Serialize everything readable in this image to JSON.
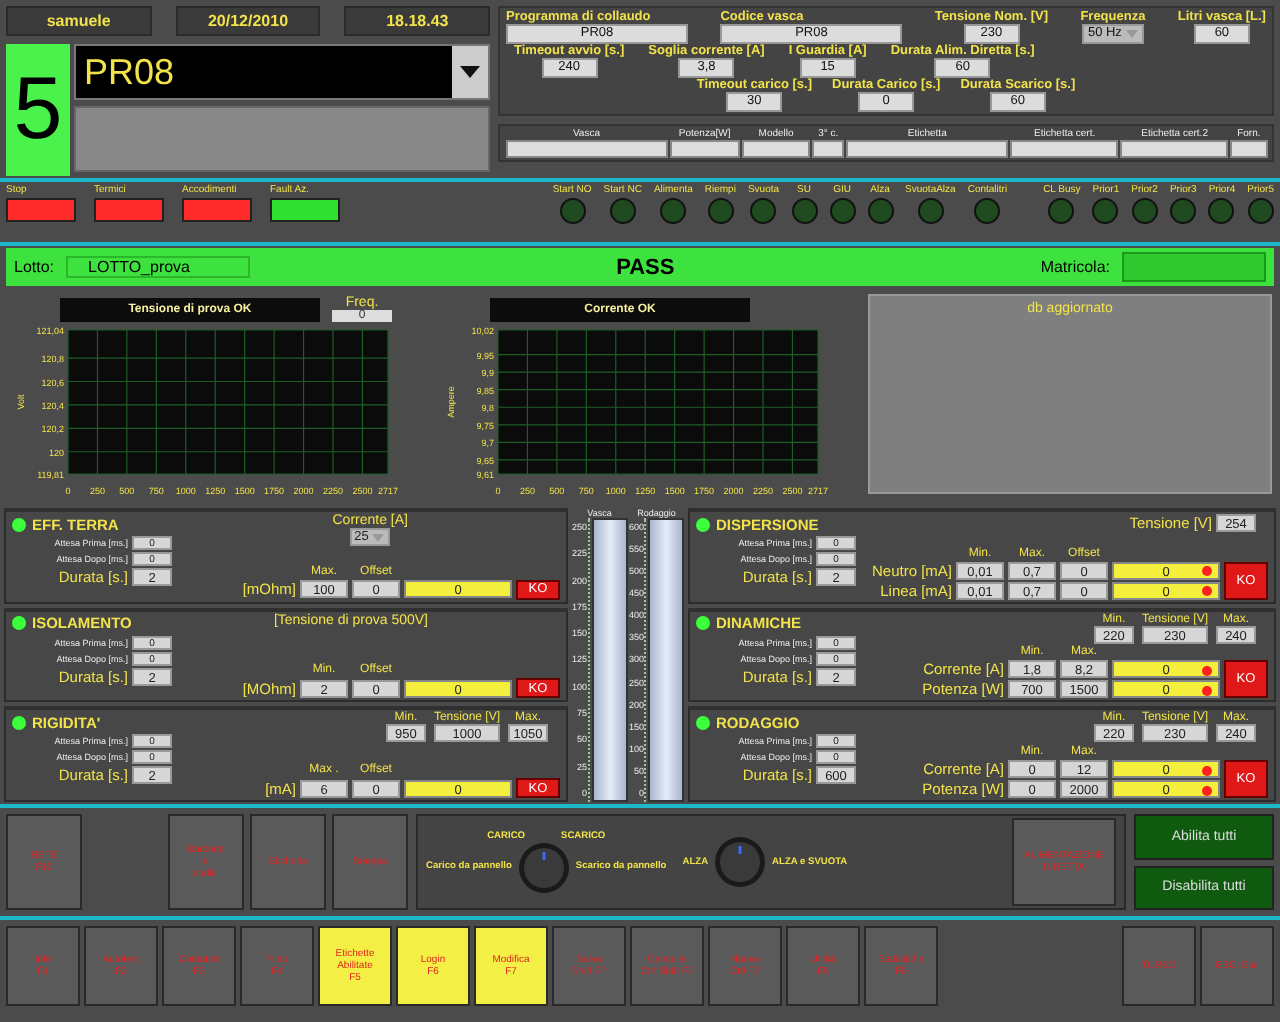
{
  "header": {
    "user": "samuele",
    "date": "20/12/2010",
    "time": "18.18.43",
    "station": "5",
    "program": "PR08"
  },
  "parameters": [
    [
      {
        "label": "Programma di collaudo",
        "value": "PR08",
        "kind": "wide"
      },
      {
        "label": "Codice vasca",
        "value": "PR08",
        "kind": "wide"
      },
      {
        "label": "Tensione Nom. [V]",
        "value": "230",
        "kind": "box"
      },
      {
        "label": "Frequenza",
        "value": "50 Hz",
        "kind": "select"
      },
      {
        "label": "Litri vasca [L.]",
        "value": "60",
        "kind": "box"
      }
    ],
    [
      {
        "label": "Timeout avvio [s.]",
        "value": "240",
        "kind": "box"
      },
      {
        "label": "Soglia corrente [A]",
        "value": "3,8",
        "kind": "box"
      },
      {
        "label": "I Guardia [A]",
        "value": "15",
        "kind": "box"
      },
      {
        "label": "Durata Alim. Diretta [s.]",
        "value": "60",
        "kind": "box"
      }
    ],
    [
      {
        "label": "Timeout carico [s.]",
        "value": "30",
        "kind": "box"
      },
      {
        "label": "Durata Carico [s.]",
        "value": "0",
        "kind": "box"
      },
      {
        "label": "Durata Scarico [s.]",
        "value": "60",
        "kind": "box"
      }
    ]
  ],
  "label_table": {
    "columns": [
      "Vasca",
      "Potenza[W]",
      "Modello",
      "3° c.",
      "Etichetta",
      "Etichetta cert.",
      "Etichetta cert.2",
      "Forn."
    ]
  },
  "alarms": [
    {
      "label": "Stop",
      "color": "#ff2a2a"
    },
    {
      "label": "Termici",
      "color": "#ff2a2a"
    },
    {
      "label": "Accodimenti",
      "color": "#ff2a2a"
    },
    {
      "label": "Fault Az.",
      "color": "#30e030"
    }
  ],
  "lamps": [
    {
      "label": "Start NO",
      "on": false
    },
    {
      "label": "Start NC",
      "on": false
    },
    {
      "label": "Alimenta",
      "on": false
    },
    {
      "label": "Riempi",
      "on": false
    },
    {
      "label": "Svuota",
      "on": false
    },
    {
      "label": "SU",
      "on": false
    },
    {
      "label": "GIU",
      "on": false
    },
    {
      "label": "Alza",
      "on": false
    },
    {
      "label": "SvuotaAlza",
      "on": false
    },
    {
      "label": "Contalitri",
      "on": false
    },
    {
      "label": "CL Busy",
      "on": false
    },
    {
      "label": "Prior1",
      "on": false
    },
    {
      "label": "Prior2",
      "on": false
    },
    {
      "label": "Prior3",
      "on": false
    },
    {
      "label": "Prior4",
      "on": false
    },
    {
      "label": "Prior5",
      "on": false
    }
  ],
  "lot": {
    "label": "Lotto:",
    "value": "LOTTO_prova",
    "result": "PASS",
    "serial_label": "Matricola:"
  },
  "charts": [
    {
      "title": "Tensione di prova OK",
      "chart_data": {
        "type": "line",
        "grid": true,
        "ylabel": "Volt",
        "xlim": [
          0,
          2717
        ],
        "ylim": [
          119.81,
          121.04
        ],
        "xticks": [
          0,
          250,
          500,
          750,
          1000,
          1250,
          1500,
          1750,
          2000,
          2250,
          2500,
          2717
        ],
        "yticks": [
          {
            "value": 119.81,
            "label": "119,81"
          },
          {
            "value": 120,
            "label": "120"
          },
          {
            "value": 120.2,
            "label": "120,2"
          },
          {
            "value": 120.4,
            "label": "120,4"
          },
          {
            "value": 120.6,
            "label": "120,6"
          },
          {
            "value": 120.8,
            "label": "120,8"
          },
          {
            "value": 121.04,
            "label": "121,04"
          }
        ]
      }
    },
    {
      "title": "Corrente OK",
      "chart_data": {
        "type": "line",
        "grid": true,
        "ylabel": "Ampere",
        "xlim": [
          0,
          2717
        ],
        "ylim": [
          9.61,
          10.02
        ],
        "xticks": [
          0,
          250,
          500,
          750,
          1000,
          1250,
          1500,
          1750,
          2000,
          2250,
          2500,
          2717
        ],
        "yticks": [
          {
            "value": 9.61,
            "label": "9,61"
          },
          {
            "value": 9.65,
            "label": "9,65"
          },
          {
            "value": 9.7,
            "label": "9,7"
          },
          {
            "value": 9.75,
            "label": "9,75"
          },
          {
            "value": 9.8,
            "label": "9,8"
          },
          {
            "value": 9.85,
            "label": "9,85"
          },
          {
            "value": 9.9,
            "label": "9,9"
          },
          {
            "value": 9.95,
            "label": "9,95"
          },
          {
            "value": 10.02,
            "label": "10,02"
          }
        ]
      }
    }
  ],
  "frequency": {
    "label": "Freq.",
    "value": "0"
  },
  "db_status": "db aggiornato",
  "tests_left": [
    {
      "title": "EFF. TERRA",
      "on": true,
      "attesa_prima": {
        "label": "Attesa Prima [ms.]",
        "value": "0"
      },
      "attesa_dopo": {
        "label": "Attesa Dopo [ms.]",
        "value": "0"
      },
      "durata": {
        "label": "Durata [s.]",
        "value": "2"
      },
      "top": [
        {
          "kind": "select",
          "label": "Corrente [A]",
          "value": "25"
        }
      ],
      "measure": {
        "headers": [
          "Max.",
          "Offset"
        ],
        "rows": [
          {
            "label": "[mOhm]",
            "values": [
              "100",
              "0"
            ],
            "result": "0",
            "alarm": false
          }
        ]
      },
      "verdict": "KO"
    },
    {
      "title": "ISOLAMENTO",
      "on": true,
      "attesa_prima": {
        "label": "Attesa Prima [ms.]",
        "value": "0"
      },
      "attesa_dopo": {
        "label": "Attesa Dopo [ms.]",
        "value": "0"
      },
      "durata": {
        "label": "Durata [s.]",
        "value": "2"
      },
      "top": [
        {
          "kind": "note",
          "text": "[Tensione di prova 500V]"
        }
      ],
      "measure": {
        "headers": [
          "Min.",
          "Offset"
        ],
        "rows": [
          {
            "label": "[MOhm]",
            "values": [
              "2",
              "0"
            ],
            "result": "0",
            "alarm": false
          }
        ]
      },
      "verdict": "KO"
    },
    {
      "title": "RIGIDITA'",
      "on": true,
      "attesa_prima": {
        "label": "Attesa Prima [ms.]",
        "value": "0"
      },
      "attesa_dopo": {
        "label": "Attesa Dopo [ms.]",
        "value": "0"
      },
      "durata": {
        "label": "Durata [s.]",
        "value": "2"
      },
      "top": [
        {
          "kind": "limits",
          "headers": [
            "Min.",
            "Tensione [V]",
            "Max."
          ],
          "values": [
            "950",
            "1000",
            "1050"
          ]
        }
      ],
      "measure": {
        "headers": [
          "Max .",
          "Offset"
        ],
        "rows": [
          {
            "label": "[mA]",
            "values": [
              "6",
              "0"
            ],
            "result": "0",
            "alarm": false
          }
        ]
      },
      "verdict": "KO"
    }
  ],
  "gauges": [
    {
      "label": "Vasca",
      "ticks": [
        "250",
        "225",
        "200",
        "175",
        "150",
        "125",
        "100",
        "75",
        "50",
        "25",
        "0"
      ]
    },
    {
      "label": "Rodaggio",
      "ticks": [
        "600",
        "550",
        "500",
        "450",
        "400",
        "350",
        "300",
        "250",
        "200",
        "150",
        "100",
        "50",
        "0"
      ]
    }
  ],
  "tests_right": [
    {
      "title": "DISPERSIONE",
      "on": true,
      "attesa_prima": {
        "label": "Attesa Prima [ms.]",
        "value": "0"
      },
      "attesa_dopo": {
        "label": "Attesa Dopo [ms.]",
        "value": "0"
      },
      "durata": {
        "label": "Durata [s.]",
        "value": "2"
      },
      "top": [
        {
          "kind": "inline",
          "label": "Tensione  [V]",
          "value": "254"
        }
      ],
      "measure": {
        "headers": [
          "Min.",
          "Max.",
          "Offset"
        ],
        "rows": [
          {
            "label": "Neutro [mA]",
            "values": [
              "0,01",
              "0,7",
              "0"
            ],
            "result": "0",
            "alarm": true
          },
          {
            "label": "Linea [mA]",
            "values": [
              "0,01",
              "0,7",
              "0"
            ],
            "result": "0",
            "alarm": true
          }
        ]
      },
      "verdict": "KO"
    },
    {
      "title": "DINAMICHE",
      "on": true,
      "attesa_prima": {
        "label": "Attesa Prima [ms.]",
        "value": "0"
      },
      "attesa_dopo": {
        "label": "Attesa Dopo [ms.]",
        "value": "0"
      },
      "durata": {
        "label": "Durata [s.]",
        "value": "2"
      },
      "top": [
        {
          "kind": "limits",
          "headers": [
            "Min.",
            "Tensione [V]",
            "Max."
          ],
          "values": [
            "220",
            "230",
            "240"
          ]
        }
      ],
      "measure": {
        "headers": [
          "Min.",
          "Max."
        ],
        "rows": [
          {
            "label": "Corrente [A]",
            "values": [
              "1,8",
              "8,2"
            ],
            "result": "0",
            "alarm": true
          },
          {
            "label": "Potenza [W]",
            "values": [
              "700",
              "1500"
            ],
            "result": "0",
            "alarm": true
          }
        ]
      },
      "verdict": "KO"
    },
    {
      "title": "RODAGGIO",
      "on": true,
      "attesa_prima": {
        "label": "Attesa Prima [ms.]",
        "value": "0"
      },
      "attesa_dopo": {
        "label": "Attesa Dopo [ms.]",
        "value": "0"
      },
      "durata": {
        "label": "Durata [s.]",
        "value": "600"
      },
      "top": [
        {
          "kind": "limits",
          "headers": [
            "Min.",
            "Tensione [V]",
            "Max."
          ],
          "values": [
            "220",
            "230",
            "240"
          ]
        }
      ],
      "measure": {
        "headers": [
          "Min.",
          "Max."
        ],
        "rows": [
          {
            "label": "Corrente [A]",
            "values": [
              "0",
              "12"
            ],
            "result": "0",
            "alarm": true
          },
          {
            "label": "Potenza [W]",
            "values": [
              "0",
              "2000"
            ],
            "result": "0",
            "alarm": true
          }
        ]
      },
      "verdict": "KO"
    }
  ],
  "controls": {
    "left_buttons": [
      "RETE\nF10",
      "Barcode\ne\ncodici",
      "Etichette",
      "Stampa"
    ],
    "knobs": [
      {
        "top_left": "CARICO",
        "top_right": "SCARICO",
        "left": "Carico da pannello",
        "right": "Scarico da pannello"
      },
      {
        "left": "ALZA",
        "right": "ALZA e SVUOTA"
      }
    ],
    "power_button": "ALIMENTAZIONE\nDIRETTA",
    "toggles": [
      "Abilita tutti",
      "Disabilita tutti"
    ]
  },
  "function_keys": [
    {
      "label": "Info\nF1",
      "selected": false
    },
    {
      "label": "Autotest\nF2",
      "selected": false
    },
    {
      "label": "Contatori\nF3",
      "selected": false
    },
    {
      "label": "Filtro\nF4",
      "selected": false
    },
    {
      "label": "Etichette\nAbilitate\nF5",
      "selected": true
    },
    {
      "label": "Login\nF6",
      "selected": true
    },
    {
      "label": "Modifica\nF7",
      "selected": true
    },
    {
      "label": "Salva\nShift F7",
      "selected": false
    },
    {
      "label": "Cancella\nCtrl Shift F7",
      "selected": false
    },
    {
      "label": "Nuovo\nCtrl F7",
      "selected": false
    },
    {
      "label": "Utilità\nF8",
      "selected": false
    },
    {
      "label": "Statistiche\nF9",
      "selected": false
    }
  ],
  "right_keys": [
    {
      "label": "TURBO",
      "selected": false
    },
    {
      "label": "ESCI Esc",
      "selected": false
    }
  ]
}
